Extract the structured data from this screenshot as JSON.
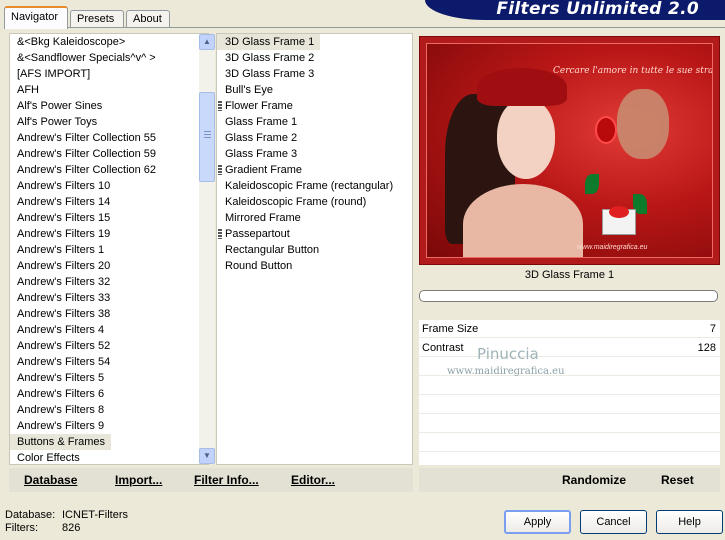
{
  "tabs": [
    {
      "label": "Navigator",
      "active": true
    },
    {
      "label": "Presets",
      "active": false
    },
    {
      "label": "About",
      "active": false
    }
  ],
  "app_title": "Filters Unlimited 2.0",
  "categories": [
    "&<Bkg Kaleidoscope>",
    "&<Sandflower Specials^v^ >",
    "[AFS IMPORT]",
    "AFH",
    "Alf's Power Sines",
    "Alf's Power Toys",
    "Andrew's Filter Collection 55",
    "Andrew's Filter Collection 59",
    "Andrew's Filter Collection 62",
    "Andrew's Filters 10",
    "Andrew's Filters 14",
    "Andrew's Filters 15",
    "Andrew's Filters 19",
    "Andrew's Filters 1",
    "Andrew's Filters 20",
    "Andrew's Filters 32",
    "Andrew's Filters 33",
    "Andrew's Filters 38",
    "Andrew's Filters 4",
    "Andrew's Filters 52",
    "Andrew's Filters 54",
    "Andrew's Filters 5",
    "Andrew's Filters 6",
    "Andrew's Filters 8",
    "Andrew's Filters 9",
    "Buttons & Frames",
    "Color Effects"
  ],
  "selected_category": "Buttons & Frames",
  "filters": [
    {
      "label": "3D Glass Frame 1",
      "marked": false,
      "selected": true
    },
    {
      "label": "3D Glass Frame 2",
      "marked": false,
      "selected": false
    },
    {
      "label": "3D Glass Frame 3",
      "marked": false,
      "selected": false
    },
    {
      "label": "Bull's Eye",
      "marked": false,
      "selected": false
    },
    {
      "label": "Flower Frame",
      "marked": true,
      "selected": false
    },
    {
      "label": "Glass Frame 1",
      "marked": false,
      "selected": false
    },
    {
      "label": "Glass Frame 2",
      "marked": false,
      "selected": false
    },
    {
      "label": "Glass Frame 3",
      "marked": false,
      "selected": false
    },
    {
      "label": "Gradient Frame",
      "marked": true,
      "selected": false
    },
    {
      "label": "Kaleidoscopic Frame (rectangular)",
      "marked": false,
      "selected": false
    },
    {
      "label": "Kaleidoscopic Frame (round)",
      "marked": false,
      "selected": false
    },
    {
      "label": "Mirrored Frame",
      "marked": false,
      "selected": false
    },
    {
      "label": "Passepartout",
      "marked": true,
      "selected": false
    },
    {
      "label": "Rectangular Button",
      "marked": false,
      "selected": false
    },
    {
      "label": "Round Button",
      "marked": false,
      "selected": false
    }
  ],
  "preview": {
    "caption": "Cercare l'amore in tutte le sue strade",
    "signature": "www.maidiregrafica.eu"
  },
  "current_filter_title": "3D Glass Frame 1",
  "params": [
    {
      "name": "Frame Size",
      "value": "7"
    },
    {
      "name": "Contrast",
      "value": "128"
    }
  ],
  "watermark": {
    "name": "Pinuccia",
    "site": "www.maidiregrafica.eu"
  },
  "toolbar": {
    "database": "Database",
    "import": "Import...",
    "filter_info": "Filter Info...",
    "editor": "Editor...",
    "randomize": "Randomize",
    "reset": "Reset"
  },
  "status": {
    "database_label": "Database:",
    "database_value": "ICNET-Filters",
    "filters_label": "Filters:",
    "filters_value": "826"
  },
  "buttons": {
    "apply": "Apply",
    "cancel": "Cancel",
    "help": "Help"
  },
  "colors": {
    "banner": "#0b1a6b",
    "preview_red": "#b11b1b",
    "active_tab_accent": "#e68b2c"
  }
}
